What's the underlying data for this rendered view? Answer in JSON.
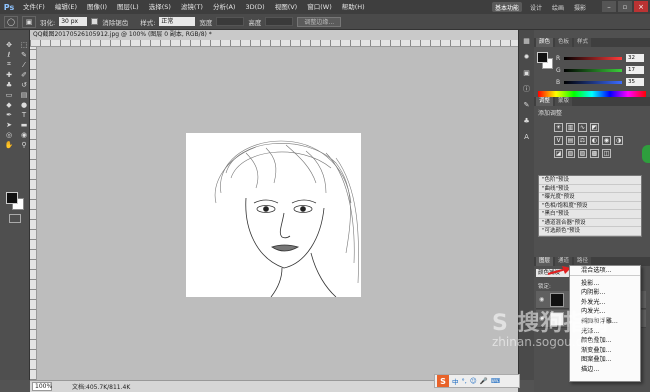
{
  "app": {
    "logo": "Ps"
  },
  "menu": [
    "文件(F)",
    "编辑(E)",
    "图像(I)",
    "图层(L)",
    "选择(S)",
    "滤镜(T)",
    "分析(A)",
    "3D(D)",
    "视图(V)",
    "窗口(W)",
    "帮助(H)"
  ],
  "workspaces": {
    "active": "基本功能",
    "others": [
      "设计",
      "绘画",
      "摄影"
    ]
  },
  "options_bar": {
    "feather_label": "羽化:",
    "feather_value": "30 px",
    "antialias_label": "消除锯齿",
    "style_label": "样式:",
    "style_value": "正常",
    "width_label": "宽度",
    "height_label": "高度",
    "refine_button": "调整边缘..."
  },
  "document": {
    "tab_title": "QQ截图20170526105912.jpg @ 100% (图层 0 副本, RGB/8) *",
    "zoom": "100%",
    "status": "文档:405.7K/811.4K"
  },
  "color_panel": {
    "tabs": [
      "颜色",
      "色板",
      "样式"
    ],
    "channels": [
      {
        "name": "R",
        "value": "32",
        "color": "#ff3b3b"
      },
      {
        "name": "G",
        "value": "17",
        "color": "#3bcf3b"
      },
      {
        "name": "B",
        "value": "35",
        "color": "#3b6bff"
      }
    ]
  },
  "adjust_panel": {
    "tabs": [
      "调整",
      "蒙版"
    ],
    "title": "添加调整",
    "presets": [
      "\"色阶\"预设",
      "\"曲线\"预设",
      "\"曝光度\"预设",
      "\"色相/饱和度\"预设",
      "\"黑白\"预设",
      "\"通道混合器\"预设",
      "\"可选颜色\"预设"
    ]
  },
  "layers_panel": {
    "tabs": [
      "图层",
      "通道",
      "路径"
    ],
    "blend_mode": "颜色减淡",
    "lock_label": "锁定:"
  },
  "context_menu": {
    "items": [
      "混合选项...",
      "投影...",
      "内阴影...",
      "外发光...",
      "内发光...",
      "斜面和浮雕...",
      "光泽...",
      "颜色叠加...",
      "渐变叠加...",
      "图案叠加...",
      "描边..."
    ]
  },
  "watermark": {
    "big": "S 搜狗指南",
    "small": "zhinan.sogou.com"
  },
  "ime": {
    "items": [
      "中",
      "°,",
      "☺",
      "🎤",
      "⌨"
    ]
  }
}
